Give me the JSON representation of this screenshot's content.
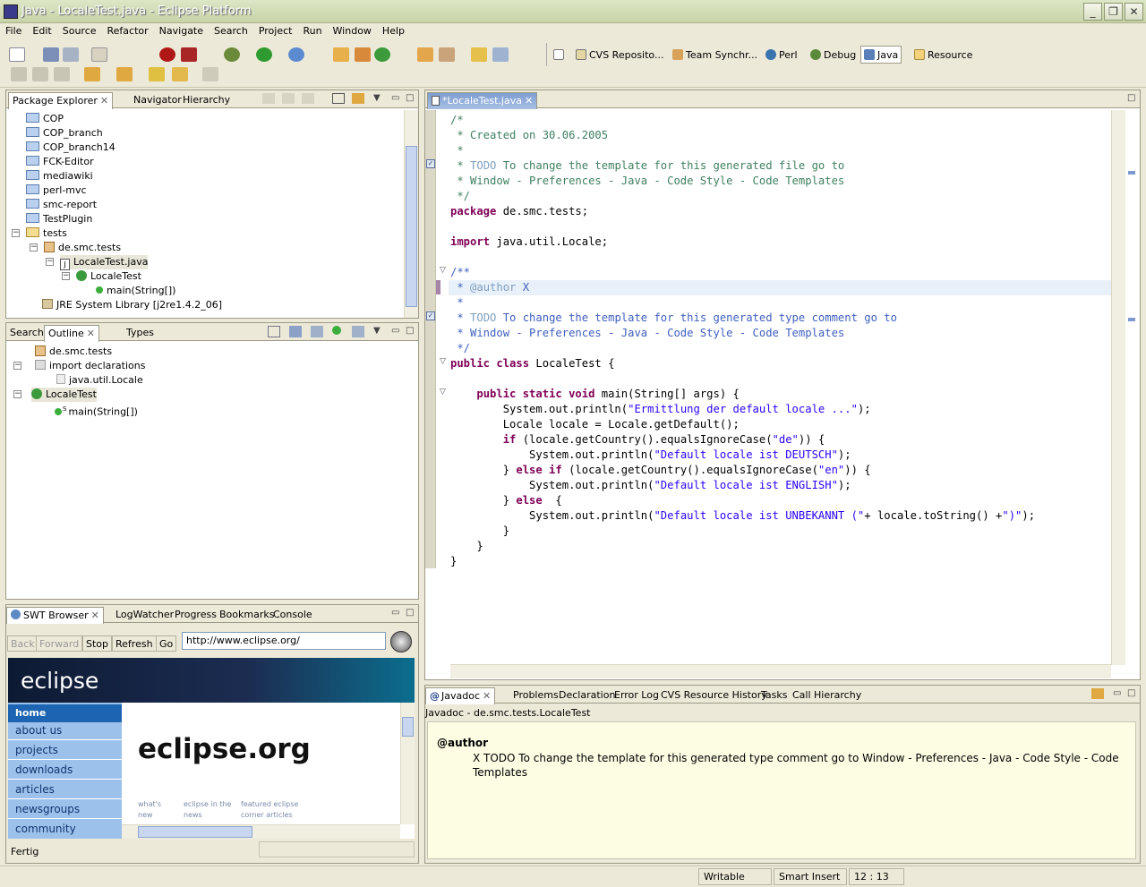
{
  "window": {
    "title": "Java - LocaleTest.java - Eclipse Platform",
    "minimize": "_",
    "maximize": "❐",
    "close": "✕"
  },
  "menu": [
    "File",
    "Edit",
    "Source",
    "Refactor",
    "Navigate",
    "Search",
    "Project",
    "Run",
    "Window",
    "Help"
  ],
  "perspectives": [
    "CVS Reposito...",
    "Team Synchr...",
    "Perl",
    "Debug",
    "Java",
    "Resource"
  ],
  "package_explorer": {
    "tabs": [
      "Package Explorer",
      "Navigator",
      "Hierarchy"
    ],
    "items": [
      "COP",
      "COP_branch",
      "COP_branch14",
      "FCK-Editor",
      "mediawiki",
      "perl-mvc",
      "smc-report",
      "TestPlugin",
      "tests",
      "de.smc.tests",
      "LocaleTest.java",
      "LocaleTest",
      "main(String[])",
      "JRE System Library [j2re1.4.2_06]"
    ]
  },
  "outline": {
    "tabs": [
      "Search",
      "Outline",
      "Types"
    ],
    "items": [
      "de.smc.tests",
      "import declarations",
      "java.util.Locale",
      "LocaleTest",
      "main(String[])"
    ],
    "static_marker": "S"
  },
  "browser": {
    "tabs": [
      "SWT Browser",
      "LogWatcher",
      "Progress",
      "Bookmarks",
      "Console"
    ],
    "buttons": [
      "Back",
      "Forward",
      "Stop",
      "Refresh",
      "Go"
    ],
    "url": "http://www.eclipse.org/",
    "logo": "eclipse",
    "nav": [
      "home",
      "about us",
      "projects",
      "downloads",
      "articles",
      "newsgroups",
      "community"
    ],
    "headline": "eclipse.org",
    "captions": [
      "what's new",
      "eclipse in the news",
      "featured eclipse corner articles"
    ],
    "status": "Fertig"
  },
  "editor": {
    "tab": "*LocaleTest.java",
    "lines": [
      [
        [
          "cm",
          "/*"
        ]
      ],
      [
        [
          "cm",
          " * Created on 30.06.2005"
        ]
      ],
      [
        [
          "cm",
          " *"
        ]
      ],
      [
        [
          "cm",
          " * "
        ],
        [
          "tg",
          "TODO"
        ],
        [
          "cm",
          " To change the template for this generated file go to"
        ]
      ],
      [
        [
          "cm",
          " * Window - Preferences - Java - Code Style - Code Templates"
        ]
      ],
      [
        [
          "cm",
          " */"
        ]
      ],
      [
        [
          "kw",
          "package"
        ],
        [
          "",
          "de.smc.tests;"
        ]
      ],
      [
        [
          "",
          ""
        ]
      ],
      [
        [
          "kw",
          "import"
        ],
        [
          "",
          "java.util.Locale;"
        ]
      ],
      [
        [
          "",
          ""
        ]
      ],
      [
        [
          "jd",
          "/**"
        ]
      ],
      [
        [
          "jd",
          " * "
        ],
        [
          "tg",
          "@author"
        ],
        [
          "jd",
          " X"
        ]
      ],
      [
        [
          "jd",
          " *"
        ]
      ],
      [
        [
          "jd",
          " * "
        ],
        [
          "tg",
          "TODO"
        ],
        [
          "jd",
          " To change the template for this generated type comment go to"
        ]
      ],
      [
        [
          "jd",
          " * Window - Preferences - Java - Code Style - Code Templates"
        ]
      ],
      [
        [
          "jd",
          " */"
        ]
      ],
      [
        [
          "kw",
          "public class"
        ],
        [
          "",
          "LocaleTest {"
        ]
      ],
      [
        [
          "",
          ""
        ]
      ],
      [
        [
          "",
          "    "
        ],
        [
          "kw",
          "public static void"
        ],
        [
          "",
          "main(String[] args) {"
        ]
      ],
      [
        [
          "",
          "        System.out.println("
        ],
        [
          "st",
          "\"Ermittlung der default locale ...\""
        ],
        [
          "",
          ");"
        ]
      ],
      [
        [
          "",
          "        Locale locale = Locale.getDefault();"
        ]
      ],
      [
        [
          "",
          "        "
        ],
        [
          "kw",
          "if"
        ],
        [
          "",
          "(locale.getCountry().equalsIgnoreCase("
        ],
        [
          "st",
          "\"de\""
        ],
        [
          "",
          ")) {"
        ]
      ],
      [
        [
          "",
          "            System.out.println("
        ],
        [
          "st",
          "\"Default locale ist DEUTSCH\""
        ],
        [
          "",
          ");"
        ]
      ],
      [
        [
          "",
          "        } "
        ],
        [
          "kw",
          "else if"
        ],
        [
          "",
          "(locale.getCountry().equalsIgnoreCase("
        ],
        [
          "st",
          "\"en\""
        ],
        [
          "",
          ")) {"
        ]
      ],
      [
        [
          "",
          "            System.out.println("
        ],
        [
          "st",
          "\"Default locale ist ENGLISH\""
        ],
        [
          "",
          ");"
        ]
      ],
      [
        [
          "",
          "        } "
        ],
        [
          "kw",
          "else"
        ],
        [
          "",
          " {"
        ]
      ],
      [
        [
          "",
          "            System.out.println("
        ],
        [
          "st",
          "\"Default locale ist UNBEKANNT (\""
        ],
        [
          "",
          "+ locale.toString() +"
        ],
        [
          "st",
          "\")\""
        ],
        [
          "",
          ");"
        ]
      ],
      [
        [
          "",
          "        }"
        ]
      ],
      [
        [
          "",
          "    }"
        ]
      ],
      [
        [
          "",
          "}"
        ]
      ]
    ]
  },
  "bottom": {
    "tabs": [
      "Javadoc",
      "Problems",
      "Declaration",
      "Error Log",
      "CVS Resource History",
      "Tasks",
      "Call Hierarchy"
    ],
    "header": "Javadoc - de.smc.tests.LocaleTest",
    "author_label": "@author",
    "author_text": "X TODO To change the template for this generated type comment go to Window - Preferences - Java - Code Style - Code Templates"
  },
  "status": {
    "writable": "Writable",
    "insert": "Smart Insert",
    "position": "12 : 13"
  }
}
